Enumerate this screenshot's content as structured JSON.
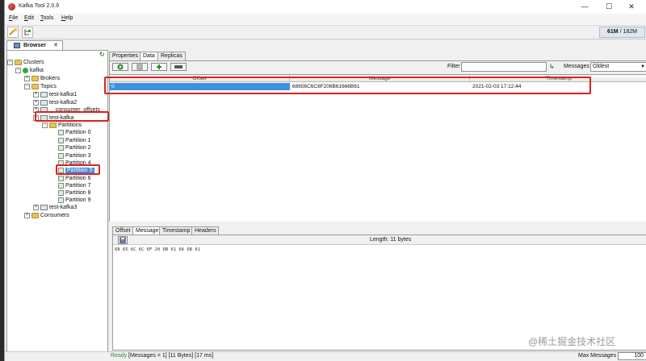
{
  "window": {
    "title": "Kafka Tool  2.0.9",
    "controls": [
      "—",
      "☐",
      "✕"
    ]
  },
  "menu": [
    {
      "label": "File",
      "underline": "F",
      "rest": "ile"
    },
    {
      "label": "Edit",
      "underline": "E",
      "rest": "dit"
    },
    {
      "label": "Tools",
      "underline": "T",
      "rest": "ools"
    },
    {
      "label": "Help",
      "underline": "H",
      "rest": "elp"
    }
  ],
  "toolbar": {
    "memory_used": "61M",
    "memory_total": "/ 182M"
  },
  "browser_tab": {
    "label": "Browser",
    "close": "✕"
  },
  "tree": {
    "clusters": "Clusters",
    "cluster_name": "kafka",
    "brokers": "Brokers",
    "topics": "Topics",
    "topic_items": [
      "test-kafka1",
      "test-kafka2",
      "__consumer_offsets"
    ],
    "selected_topic": "test-kafka",
    "partitions_label": "Partitions",
    "partitions": [
      "Partition 0",
      "Partition 1",
      "Partition 2",
      "Partition 3",
      "Partition 4",
      "Partition 5",
      "Partition 6",
      "Partition 7",
      "Partition 8",
      "Partition 9"
    ],
    "selected_partition": "Partition 5",
    "topic_after": "test-kafka3",
    "consumers": "Consumers"
  },
  "main_tabs": [
    "Properties",
    "Data",
    "Replicas"
  ],
  "active_main_tab": "Data",
  "filter": {
    "label": "Filter",
    "value": "",
    "messages_label": "Messages",
    "messages_selected": "Oldest"
  },
  "grid": {
    "columns": [
      "Offset",
      "Message",
      "Timestamp"
    ],
    "rows": [
      {
        "offset": "0",
        "message": "68656C6C6F206B61666B61",
        "timestamp": "2021-02-03 17:12:44"
      }
    ]
  },
  "detail_tabs": [
    "Offset",
    "Message",
    "Timestamp",
    "Headers"
  ],
  "active_detail_tab": "Message",
  "detail": {
    "length": "Length: 11 bytes",
    "hex": "68 65 6C 6C 6F 20 6B 61 66 6B 61"
  },
  "status": {
    "ready": "Ready",
    "stats": "[Messages = 1]  [11 Bytes]  [17 ms]",
    "max_messages_label": "Max Messages",
    "max_messages_value": "100"
  },
  "watermark": "@稀土掘金技术社区",
  "colors": {
    "selection": "#3d8fe2",
    "highlight_box": "#e0201c",
    "ready_green": "#2d8a2d"
  }
}
